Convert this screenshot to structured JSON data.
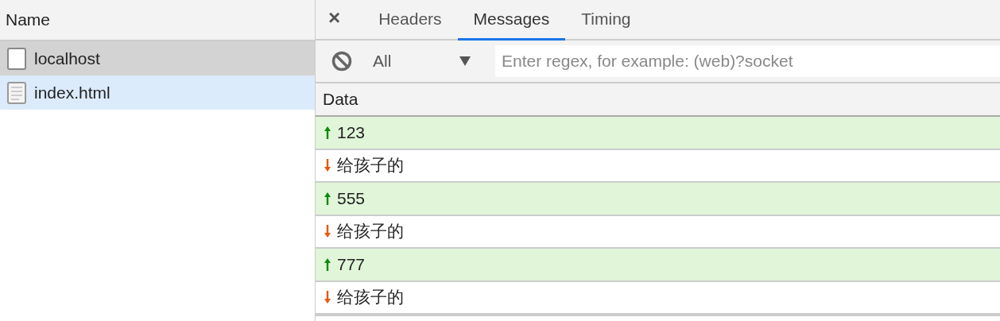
{
  "requests": {
    "column": "Name",
    "items": [
      {
        "name": "localhost",
        "kind": "blank",
        "hovered": true,
        "selected": false
      },
      {
        "name": "index.html",
        "kind": "document",
        "selected": true
      }
    ]
  },
  "detail": {
    "close": "×",
    "tabs": [
      {
        "label": "Headers",
        "selected": false
      },
      {
        "label": "Messages",
        "selected": true
      },
      {
        "label": "Timing",
        "selected": false
      }
    ],
    "filter": {
      "type": "All",
      "placeholder": "Enter regex, for example: (web)?socket"
    },
    "column": "Data",
    "messages": [
      {
        "kind": "sent",
        "text": "123"
      },
      {
        "kind": "received",
        "text": "给孩子的"
      },
      {
        "kind": "sent",
        "text": "555"
      },
      {
        "kind": "received",
        "text": "给孩子的"
      },
      {
        "kind": "sent",
        "text": "777"
      },
      {
        "kind": "received",
        "text": "给孩子的"
      }
    ]
  }
}
